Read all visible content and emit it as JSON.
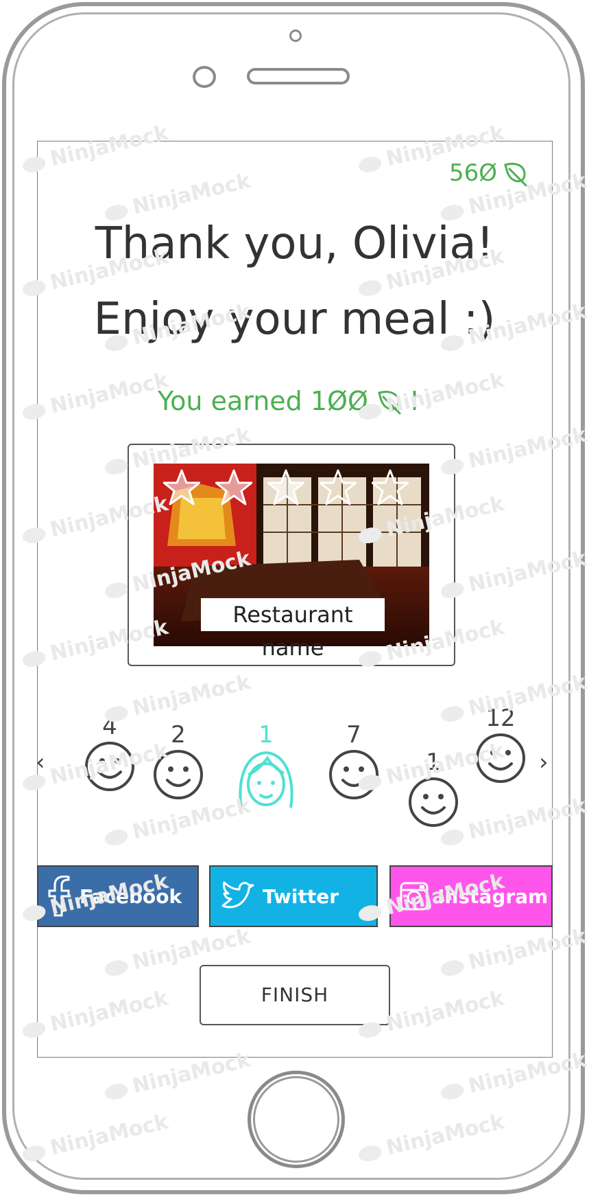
{
  "header": {
    "points": "56Ø",
    "points_icon": "leaf-icon"
  },
  "greeting": {
    "line1": "Thank you, Olivia!",
    "line2": "Enjoy your meal :)"
  },
  "reward": {
    "prefix": "You earned 1ØØ",
    "suffix": "!"
  },
  "restaurant": {
    "name": "Restaurant name",
    "rating": 3,
    "rating_max": 5
  },
  "carousel": {
    "people": [
      {
        "count": "4"
      },
      {
        "count": "2"
      },
      {
        "count": "1"
      },
      {
        "count": "7"
      },
      {
        "count": "1"
      },
      {
        "count": "12"
      }
    ],
    "prev_icon": "chevron-left-icon",
    "next_icon": "chevron-right-icon"
  },
  "social": {
    "facebook": "Facebook",
    "twitter": "Twitter",
    "instagram": "Instagram"
  },
  "actions": {
    "finish": "FINISH"
  },
  "colors": {
    "accent_green": "#4caf50",
    "facebook": "#3b6ea8",
    "twitter": "#12b3e4",
    "instagram": "#ff55ea",
    "active_avatar": "#4fe0d2"
  }
}
